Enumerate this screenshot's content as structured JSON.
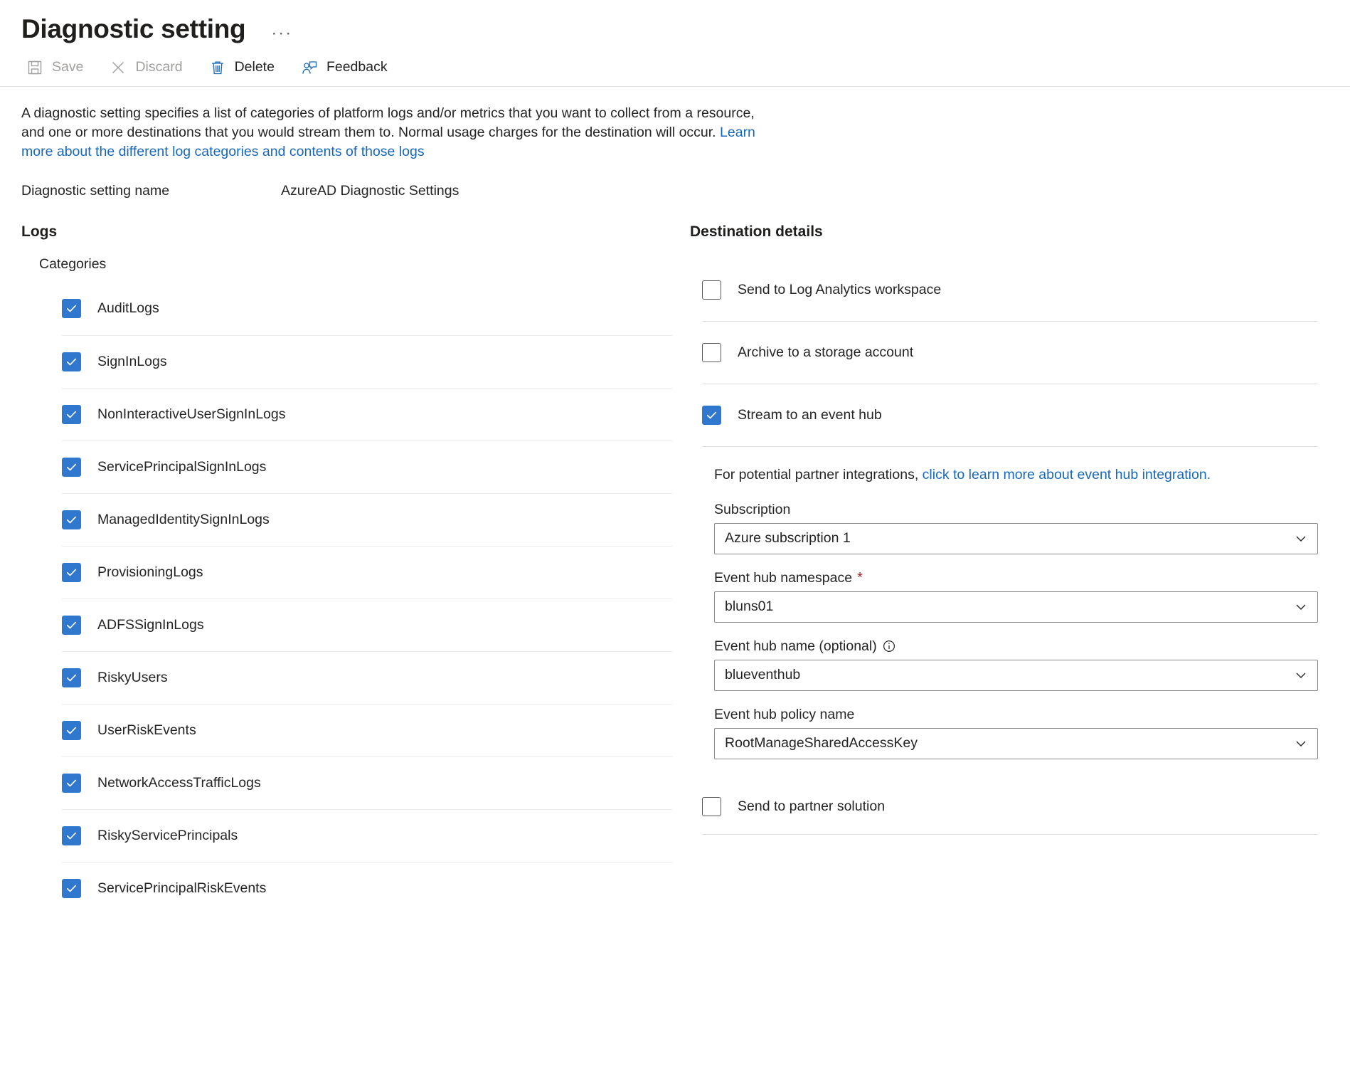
{
  "header": {
    "title": "Diagnostic setting",
    "ellipsis": "···"
  },
  "toolbar": {
    "items": [
      {
        "label": "Save",
        "icon": "save-icon",
        "enabled": false
      },
      {
        "label": "Discard",
        "icon": "discard-icon",
        "enabled": false
      },
      {
        "label": "Delete",
        "icon": "delete-icon",
        "enabled": true
      },
      {
        "label": "Feedback",
        "icon": "feedback-icon",
        "enabled": true
      }
    ]
  },
  "description": {
    "part1": "A diagnostic setting specifies a list of categories of platform logs and/or metrics that you want to collect from a resource, and one or more destinations that you would stream them to. Normal usage charges for the destination will occur. ",
    "link": "Learn more about the different log categories and contents of those logs"
  },
  "setting_name": {
    "label": "Diagnostic setting name",
    "value": "AzureAD Diagnostic Settings"
  },
  "logs": {
    "heading": "Logs",
    "subheading": "Categories",
    "categories": [
      {
        "label": "AuditLogs",
        "checked": true
      },
      {
        "label": "SignInLogs",
        "checked": true
      },
      {
        "label": "NonInteractiveUserSignInLogs",
        "checked": true
      },
      {
        "label": "ServicePrincipalSignInLogs",
        "checked": true
      },
      {
        "label": "ManagedIdentitySignInLogs",
        "checked": true
      },
      {
        "label": "ProvisioningLogs",
        "checked": true
      },
      {
        "label": "ADFSSignInLogs",
        "checked": true
      },
      {
        "label": "RiskyUsers",
        "checked": true
      },
      {
        "label": "UserRiskEvents",
        "checked": true
      },
      {
        "label": "NetworkAccessTrafficLogs",
        "checked": true
      },
      {
        "label": "RiskyServicePrincipals",
        "checked": true
      },
      {
        "label": "ServicePrincipalRiskEvents",
        "checked": true
      }
    ]
  },
  "destination": {
    "heading": "Destination details",
    "log_analytics": {
      "label": "Send to Log Analytics workspace",
      "checked": false
    },
    "storage": {
      "label": "Archive to a storage account",
      "checked": false
    },
    "event_hub": {
      "label": "Stream to an event hub",
      "checked": true
    },
    "partner_note": {
      "text": "For potential partner integrations, ",
      "link": "click to learn more about event hub integration."
    },
    "fields": {
      "subscription": {
        "label": "Subscription",
        "value": "Azure subscription 1",
        "required": false
      },
      "namespace": {
        "label": "Event hub namespace",
        "value": "bluns01",
        "required": true,
        "star": "*"
      },
      "hub_name": {
        "label": "Event hub name (optional)",
        "value": "blueventhub",
        "required": false,
        "info": "info-icon"
      },
      "policy": {
        "label": "Event hub policy name",
        "value": "RootManageSharedAccessKey",
        "required": false
      }
    },
    "partner_solution": {
      "label": "Send to partner solution",
      "checked": false
    }
  },
  "colors": {
    "accent": "#3078ce",
    "link": "#1768bd",
    "required": "#a4262c",
    "text": "#242424",
    "border": "#e1dfdd"
  }
}
